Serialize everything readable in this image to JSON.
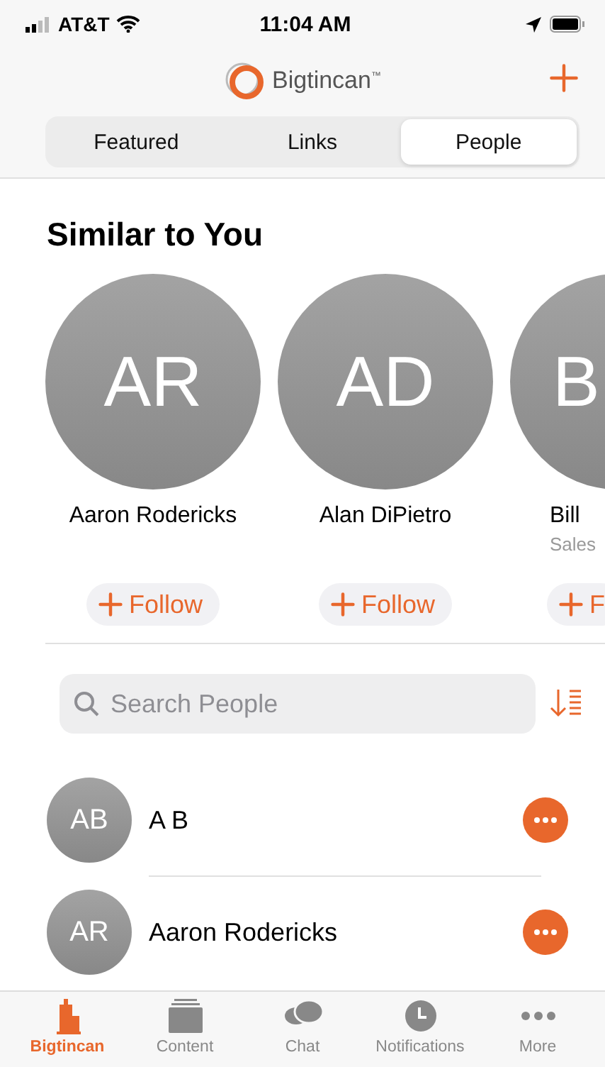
{
  "status_bar": {
    "carrier": "AT&T",
    "time": "11:04 AM"
  },
  "header": {
    "logo_text": "Bigtincan",
    "logo_mark": "™"
  },
  "segments": [
    {
      "label": "Featured",
      "selected": false
    },
    {
      "label": "Links",
      "selected": false
    },
    {
      "label": "People",
      "selected": true
    }
  ],
  "similar": {
    "title": "Similar to You",
    "people": [
      {
        "initials": "AR",
        "name": "Aaron Rodericks",
        "follow": "Follow",
        "partial": false
      },
      {
        "initials": "AD",
        "name": "Alan DiPietro",
        "follow": "Follow",
        "partial": false
      },
      {
        "initials": "B",
        "name": "Bill",
        "subtitle": "Sales",
        "follow": "F",
        "partial": true
      }
    ]
  },
  "search": {
    "placeholder": "Search People"
  },
  "people": [
    {
      "initials": "AB",
      "name": "A B"
    },
    {
      "initials": "AR",
      "name": "Aaron Rodericks"
    }
  ],
  "tab_bar": [
    {
      "label": "Bigtincan",
      "kind": "home",
      "selected": true
    },
    {
      "label": "Content",
      "kind": "content",
      "selected": false
    },
    {
      "label": "Chat",
      "kind": "chat",
      "selected": false
    },
    {
      "label": "Notifications",
      "kind": "notifications",
      "selected": false
    },
    {
      "label": "More",
      "kind": "more",
      "selected": false
    }
  ]
}
